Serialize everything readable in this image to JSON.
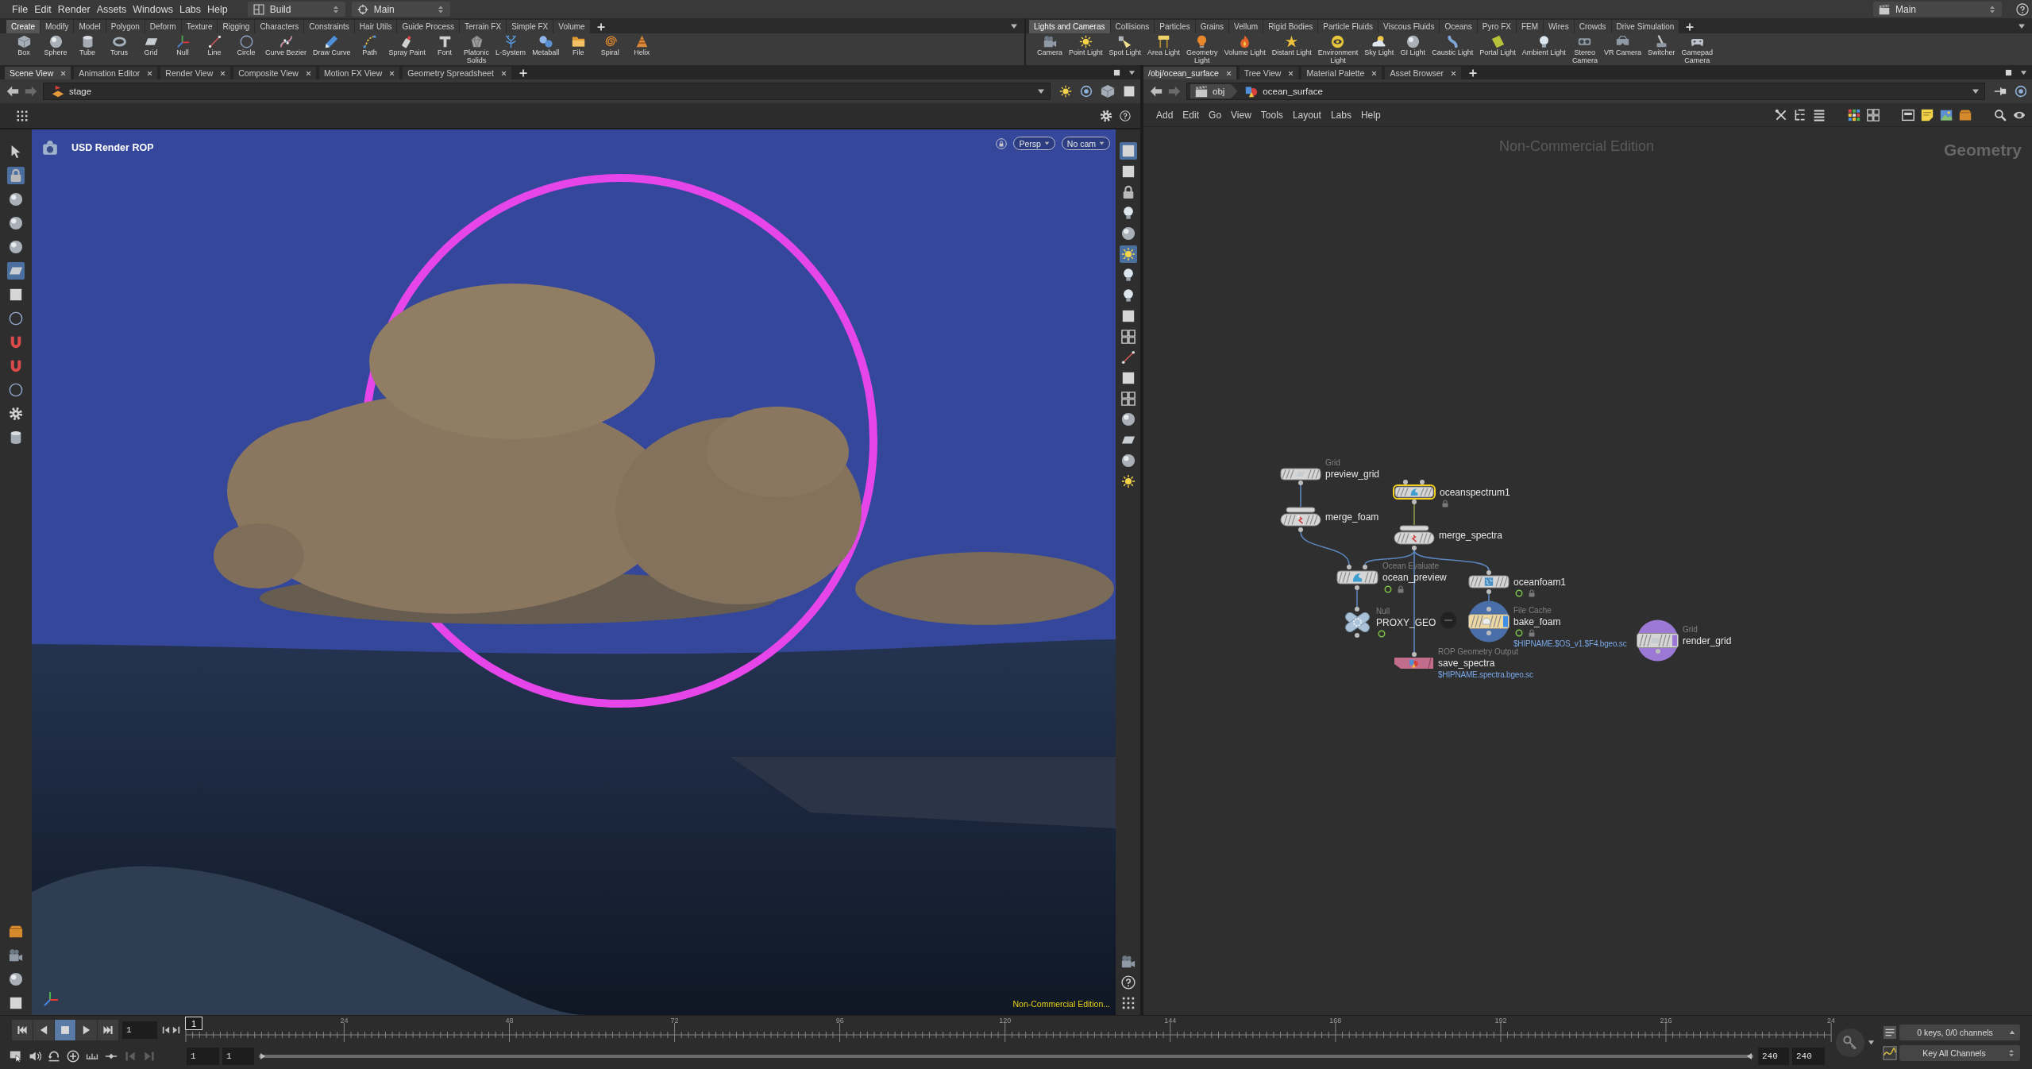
{
  "menu_bar": {
    "menus": [
      "File",
      "Edit",
      "Render",
      "Assets",
      "Windows",
      "Labs",
      "Help"
    ],
    "desktop": "Build",
    "context": "Main",
    "workspace": "Main"
  },
  "shelves": [
    {
      "tabs": [
        {
          "label": "Create",
          "selected": true
        },
        {
          "label": "Modify",
          "selected": false
        },
        {
          "label": "Model",
          "selected": false
        },
        {
          "label": "Polygon",
          "selected": false
        },
        {
          "label": "Deform",
          "selected": false
        },
        {
          "label": "Texture",
          "selected": false
        },
        {
          "label": "Rigging",
          "selected": false
        },
        {
          "label": "Characters",
          "selected": false
        },
        {
          "label": "Constraints",
          "selected": false
        },
        {
          "label": "Hair Utils",
          "selected": false
        },
        {
          "label": "Guide Process",
          "selected": false
        },
        {
          "label": "Terrain FX",
          "selected": false
        },
        {
          "label": "Simple FX",
          "selected": false
        },
        {
          "label": "Volume",
          "selected": false
        }
      ],
      "tools": [
        "Box",
        "Sphere",
        "Tube",
        "Torus",
        "Grid",
        "Null",
        "Line",
        "Circle",
        "Curve Bezier",
        "Draw Curve",
        "Path",
        "Spray Paint",
        "Font",
        "Platonic\nSolids",
        "L-System",
        "Metaball",
        "File",
        "Spiral",
        "Helix"
      ]
    },
    {
      "tabs": [
        {
          "label": "Lights and Cameras",
          "selected": true
        },
        {
          "label": "Collisions",
          "selected": false
        },
        {
          "label": "Particles",
          "selected": false
        },
        {
          "label": "Grains",
          "selected": false
        },
        {
          "label": "Vellum",
          "selected": false
        },
        {
          "label": "Rigid Bodies",
          "selected": false
        },
        {
          "label": "Particle Fluids",
          "selected": false
        },
        {
          "label": "Viscous Fluids",
          "selected": false
        },
        {
          "label": "Oceans",
          "selected": false
        },
        {
          "label": "Pyro FX",
          "selected": false
        },
        {
          "label": "FEM",
          "selected": false
        },
        {
          "label": "Wires",
          "selected": false
        },
        {
          "label": "Crowds",
          "selected": false
        },
        {
          "label": "Drive Simulation",
          "selected": false
        }
      ],
      "tools": [
        "Camera",
        "Point Light",
        "Spot Light",
        "Area Light",
        "Geometry\nLight",
        "Volume Light",
        "Distant Light",
        "Environment\nLight",
        "Sky Light",
        "GI Light",
        "Caustic Light",
        "Portal Light",
        "Ambient Light",
        "Stereo\nCamera",
        "VR Camera",
        "Switcher",
        "Gamepad\nCamera"
      ]
    }
  ],
  "scene_pane": {
    "tabs": [
      {
        "label": "Scene View",
        "selected": true
      },
      {
        "label": "Animation Editor",
        "selected": false
      },
      {
        "label": "Render View",
        "selected": false
      },
      {
        "label": "Composite View",
        "selected": false
      },
      {
        "label": "Motion FX View",
        "selected": false
      },
      {
        "label": "Geometry Spreadsheet",
        "selected": false
      }
    ],
    "path": "stage",
    "tools": [
      {
        "selected": false
      },
      {
        "selected": true
      },
      {
        "selected": false
      },
      {
        "selected": false
      },
      {
        "selected": false
      },
      {
        "selected": true
      },
      {
        "selected": false
      },
      {
        "selected": false
      },
      {
        "selected": false
      },
      {
        "selected": false
      },
      {
        "selected": false
      },
      {
        "selected": false
      },
      {
        "selected": false
      }
    ],
    "bottom_tools": [
      {
        "selected": false
      },
      {
        "selected": false
      },
      {
        "selected": false
      },
      {
        "selected": false
      }
    ],
    "display_tools": [
      {
        "selected": true
      },
      {
        "selected": false
      },
      {
        "selected": false
      },
      {
        "selected": false
      },
      {
        "selected": false
      },
      {
        "selected": true
      },
      {
        "selected": false
      },
      {
        "selected": false
      },
      {
        "selected": false
      },
      {
        "selected": false
      },
      {
        "selected": false
      },
      {
        "selected": false
      },
      {
        "selected": false
      },
      {
        "selected": false
      },
      {
        "selected": false
      },
      {
        "selected": false
      },
      {
        "selected": false
      }
    ],
    "bottom_display_tools": [
      {
        "selected": false
      },
      {
        "selected": false
      },
      {
        "selected": false
      }
    ],
    "viewport": {
      "title": "USD Render ROP",
      "view": "Persp",
      "camera": "No cam",
      "notice": "Non-Commercial Edition..."
    }
  },
  "network_pane": {
    "tabs": [
      {
        "label": "/obj/ocean_surface",
        "selected": true
      },
      {
        "label": "Tree View",
        "selected": false
      },
      {
        "label": "Material Palette",
        "selected": false
      },
      {
        "label": "Asset Browser",
        "selected": false
      }
    ],
    "path": [
      "obj",
      "ocean_surface"
    ],
    "menus": [
      "Add",
      "Edit",
      "Go",
      "View",
      "Tools",
      "Layout",
      "Labs",
      "Help"
    ],
    "notice": "Non-Commercial Edition",
    "context": "Geometry",
    "nodes": [
      {
        "kind": "box",
        "type": "Grid",
        "name": "preview_grid",
        "color": "#d6d6d6",
        "selected": false,
        "status_ring": false,
        "locked": false
      },
      {
        "kind": "box",
        "name": "oceanspectrum1",
        "color": "#d6d6d6",
        "selected": true,
        "status_ring": false,
        "locked": true
      },
      {
        "kind": "merge",
        "name": "merge_foam",
        "color": "#d6d6d6",
        "selected": false,
        "status_ring": false,
        "locked": false
      },
      {
        "kind": "merge",
        "name": "merge_spectra",
        "color": "#d6d6d6",
        "selected": false,
        "status_ring": false,
        "locked": false
      },
      {
        "kind": "box",
        "type": "Ocean Evaluate",
        "name": "ocean_preview",
        "color": "#d6d6d6",
        "selected": false,
        "status_ring": true,
        "locked": true
      },
      {
        "kind": "box",
        "name": "oceanfoam1",
        "color": "#d6d6d6",
        "selected": false,
        "status_ring": true,
        "locked": true
      },
      {
        "kind": "null",
        "type": "Null",
        "name": "PROXY_GEO",
        "color": "#a9c2d8",
        "selected": false,
        "status_ring": true,
        "locked": false
      },
      {
        "kind": "cache",
        "type": "File Cache",
        "name": "bake_foam",
        "color": "#4a6ea8",
        "selected": false,
        "status_ring": true,
        "locked": true,
        "path": "$HIPNAME.$OS_v1.$F4.bgeo.sc"
      },
      {
        "kind": "rop",
        "type": "ROP Geometry Output",
        "name": "save_spectra",
        "color": "#c26d8b",
        "selected": false,
        "status_ring": false,
        "locked": false,
        "path": "$HIPNAME.spectra.bgeo.sc"
      },
      {
        "kind": "circle",
        "type": "Grid",
        "name": "render_grid",
        "color": "#9b79d4",
        "selected": false,
        "status_ring": false,
        "locked": false
      }
    ]
  },
  "timeline": {
    "transport": [
      {
        "kind": "first",
        "selected": false
      },
      {
        "kind": "reverse",
        "selected": false
      },
      {
        "kind": "stop",
        "selected": true
      },
      {
        "kind": "play",
        "selected": false
      },
      {
        "kind": "last",
        "selected": false
      }
    ],
    "frame": "1",
    "tools": [
      {
        "disabled": false
      },
      {
        "disabled": false
      },
      {
        "disabled": false
      },
      {
        "disabled": false
      },
      {
        "disabled": false
      },
      {
        "disabled": false
      },
      {
        "disabled": true
      },
      {
        "disabled": true
      }
    ],
    "ruler_labels": [
      "24",
      "48",
      "72",
      "96",
      "120",
      "144",
      "168",
      "192",
      "216",
      "24"
    ],
    "current_frame": "1",
    "range_start": "1",
    "range_start_2": "1",
    "range_end": "240",
    "range_end_2": "240",
    "keys": "0 keys, 0/0 channels",
    "key_mode": "Key All Channels"
  }
}
